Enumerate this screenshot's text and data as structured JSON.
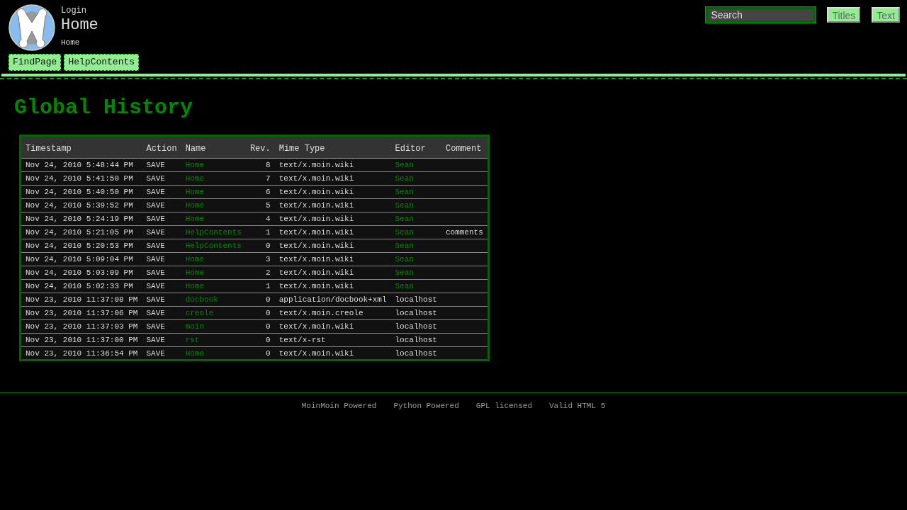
{
  "header": {
    "login": "Login",
    "page_title": "Home",
    "breadcrumb": "Home",
    "nav_links": [
      "FindPage",
      "HelpContents"
    ]
  },
  "search": {
    "placeholder": "Search",
    "buttons": [
      "Titles",
      "Text"
    ]
  },
  "heading": "Global History",
  "table": {
    "columns": [
      "Timestamp",
      "Action",
      "Name",
      "Rev.",
      "Mime Type",
      "Editor",
      "Comment"
    ],
    "rows": [
      {
        "timestamp": "Nov 24, 2010 5:48:44 PM",
        "action": "SAVE",
        "name": "Home",
        "rev": "8",
        "mime": "text/x.moin.wiki",
        "editor": "Sean",
        "editor_link": true
      },
      {
        "timestamp": "Nov 24, 2010 5:41:50 PM",
        "action": "SAVE",
        "name": "Home",
        "rev": "7",
        "mime": "text/x.moin.wiki",
        "editor": "Sean",
        "editor_link": true
      },
      {
        "timestamp": "Nov 24, 2010 5:40:50 PM",
        "action": "SAVE",
        "name": "Home",
        "rev": "6",
        "mime": "text/x.moin.wiki",
        "editor": "Sean",
        "editor_link": true
      },
      {
        "timestamp": "Nov 24, 2010 5:39:52 PM",
        "action": "SAVE",
        "name": "Home",
        "rev": "5",
        "mime": "text/x.moin.wiki",
        "editor": "Sean",
        "editor_link": true
      },
      {
        "timestamp": "Nov 24, 2010 5:24:19 PM",
        "action": "SAVE",
        "name": "Home",
        "rev": "4",
        "mime": "text/x.moin.wiki",
        "editor": "Sean",
        "editor_link": true
      },
      {
        "timestamp": "Nov 24, 2010 5:21:05 PM",
        "action": "SAVE",
        "name": "HelpContents",
        "rev": "1",
        "mime": "text/x.moin.wiki",
        "editor": "Sean",
        "editor_link": true,
        "comment": "comments"
      },
      {
        "timestamp": "Nov 24, 2010 5:20:53 PM",
        "action": "SAVE",
        "name": "HelpContents",
        "rev": "0",
        "mime": "text/x.moin.wiki",
        "editor": "Sean",
        "editor_link": true
      },
      {
        "timestamp": "Nov 24, 2010 5:09:04 PM",
        "action": "SAVE",
        "name": "Home",
        "rev": "3",
        "mime": "text/x.moin.wiki",
        "editor": "Sean",
        "editor_link": true
      },
      {
        "timestamp": "Nov 24, 2010 5:03:09 PM",
        "action": "SAVE",
        "name": "Home",
        "rev": "2",
        "mime": "text/x.moin.wiki",
        "editor": "Sean",
        "editor_link": true
      },
      {
        "timestamp": "Nov 24, 2010 5:02:33 PM",
        "action": "SAVE",
        "name": "Home",
        "rev": "1",
        "mime": "text/x.moin.wiki",
        "editor": "Sean",
        "editor_link": true
      },
      {
        "timestamp": "Nov 23, 2010 11:37:08 PM",
        "action": "SAVE",
        "name": "docbook",
        "rev": "0",
        "mime": "application/docbook+xml",
        "editor": "localhost",
        "editor_link": false
      },
      {
        "timestamp": "Nov 23, 2010 11:37:06 PM",
        "action": "SAVE",
        "name": "creole",
        "rev": "0",
        "mime": "text/x.moin.creole",
        "editor": "localhost",
        "editor_link": false
      },
      {
        "timestamp": "Nov 23, 2010 11:37:03 PM",
        "action": "SAVE",
        "name": "moin",
        "rev": "0",
        "mime": "text/x.moin.wiki",
        "editor": "localhost",
        "editor_link": false
      },
      {
        "timestamp": "Nov 23, 2010 11:37:00 PM",
        "action": "SAVE",
        "name": "rst",
        "rev": "0",
        "mime": "text/x-rst",
        "editor": "localhost",
        "editor_link": false
      },
      {
        "timestamp": "Nov 23, 2010 11:36:54 PM",
        "action": "SAVE",
        "name": "Home",
        "rev": "0",
        "mime": "text/x.moin.wiki",
        "editor": "localhost",
        "editor_link": false
      }
    ]
  },
  "footer": [
    "MoinMoin Powered",
    "Python Powered",
    "GPL licensed",
    "Valid HTML 5"
  ]
}
